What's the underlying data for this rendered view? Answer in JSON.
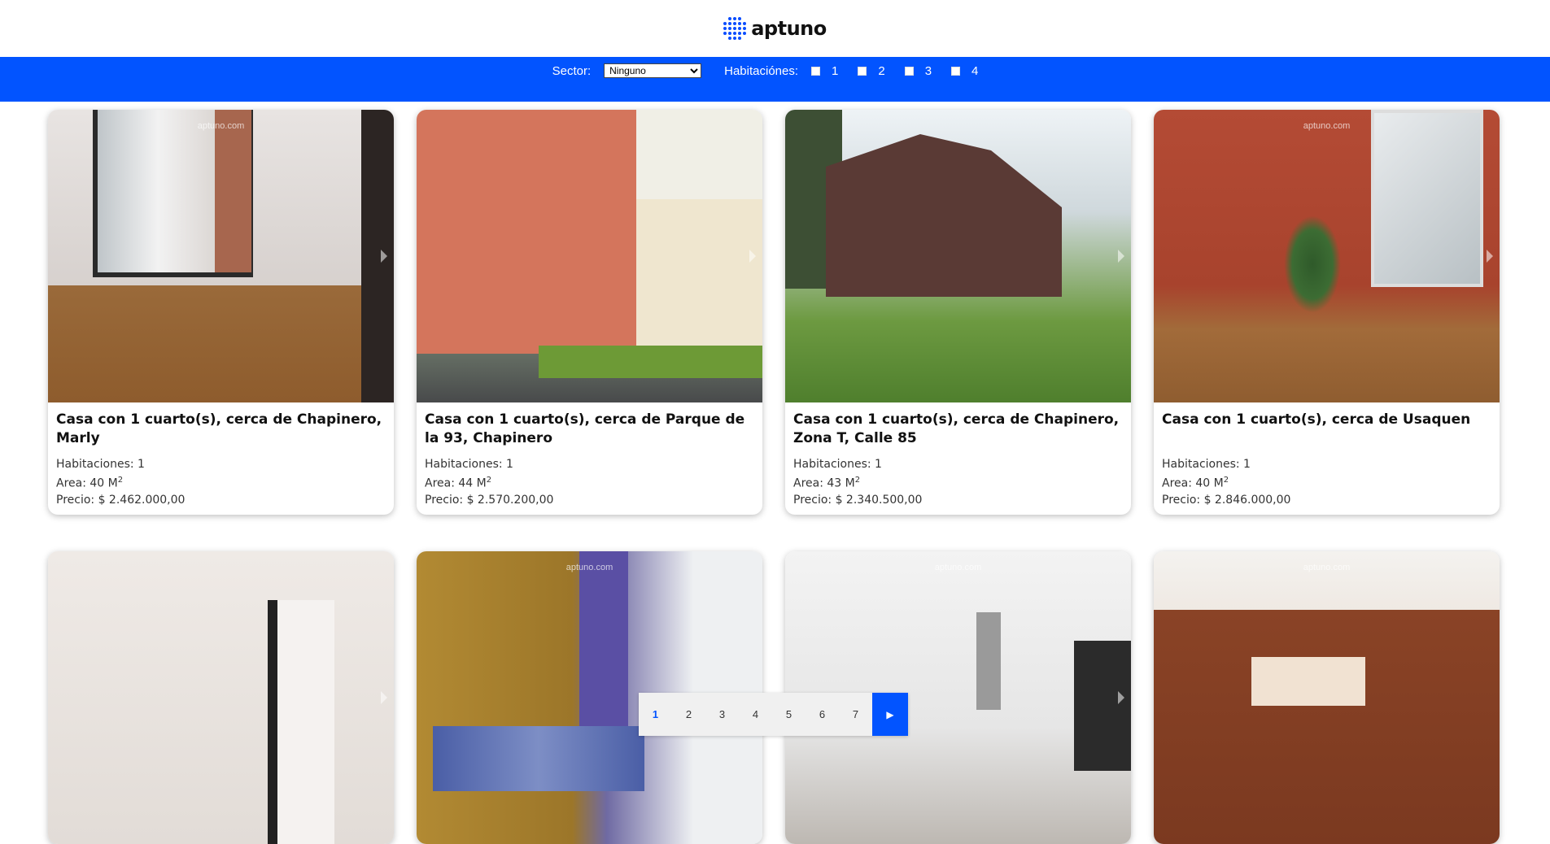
{
  "brand": {
    "logo_text": "aptuno",
    "accent_color": "#0254ff"
  },
  "filters": {
    "sector_label": "Sector:",
    "sector_value": "Ninguno",
    "rooms_label": "Habitaciónes:",
    "rooms_options": [
      "1",
      "2",
      "3",
      "4"
    ]
  },
  "listings": [
    {
      "title": "Casa con 1 cuarto(s), cerca de Chapinero, Marly",
      "rooms": "Habitaciones: 1",
      "area_label": "Area: 40 M",
      "area_sup": "2",
      "price": "Precio: $ 2.462.000,00",
      "watermark": "aptuno.com"
    },
    {
      "title": "Casa con 1 cuarto(s), cerca de Parque de la 93, Chapinero",
      "rooms": "Habitaciones: 1",
      "area_label": "Area: 44 M",
      "area_sup": "2",
      "price": "Precio: $ 2.570.200,00",
      "watermark": ""
    },
    {
      "title": "Casa con 1 cuarto(s), cerca de Chapinero, Zona T, Calle 85",
      "rooms": "Habitaciones: 1",
      "area_label": "Area: 43 M",
      "area_sup": "2",
      "price": "Precio: $ 2.340.500,00",
      "watermark": ""
    },
    {
      "title": "Casa con 1 cuarto(s), cerca de Usaquen",
      "rooms": "Habitaciones: 1",
      "area_label": "Area: 40 M",
      "area_sup": "2",
      "price": "Precio: $ 2.846.000,00",
      "watermark": "aptuno.com"
    },
    {
      "watermark": ""
    },
    {
      "watermark": "aptuno.com"
    },
    {
      "watermark": "aptuno.com"
    },
    {
      "watermark": "aptuno.com"
    }
  ],
  "pagination": {
    "pages": [
      "1",
      "2",
      "3",
      "4",
      "5",
      "6",
      "7"
    ],
    "active": "1",
    "next_icon": "play-arrow-icon"
  }
}
